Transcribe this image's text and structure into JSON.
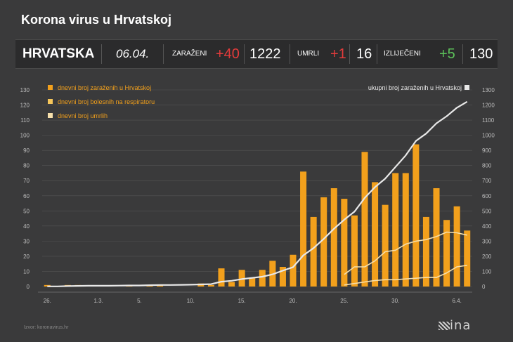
{
  "header": {
    "title": "Korona virus u Hrvatskoj"
  },
  "stats": {
    "country": "HRVATSKA",
    "date": "06.04.",
    "infected_label": "ZARAŽENI",
    "infected_delta": "+40",
    "infected_total": "1222",
    "deaths_label": "UMRLI",
    "deaths_delta": "+1",
    "deaths_total": "16",
    "recovered_label": "IZLIJEČENI",
    "recovered_delta": "+5",
    "recovered_total": "130"
  },
  "colors": {
    "background": "#3a3a3b",
    "bar": "#f2a01c",
    "line_white": "#e8e8e8",
    "line_cream": "#f6dfab",
    "grid": "#555555",
    "red": "#e23b3b",
    "green": "#5cc25a"
  },
  "chart_data": {
    "type": "bar",
    "x_tick_labels": [
      {
        "index": 0,
        "label": "26."
      },
      {
        "index": 5,
        "label": "1.3."
      },
      {
        "index": 9,
        "label": "5."
      },
      {
        "index": 14,
        "label": "10."
      },
      {
        "index": 19,
        "label": "15."
      },
      {
        "index": 24,
        "label": "20."
      },
      {
        "index": 29,
        "label": "25."
      },
      {
        "index": 34,
        "label": "30."
      },
      {
        "index": 40,
        "label": "6.4."
      }
    ],
    "left_axis": {
      "ylim": [
        0,
        130
      ],
      "ticks": [
        "0",
        "10",
        "20",
        "30",
        "40",
        "50",
        "60",
        "70",
        "80",
        "90",
        "100",
        "110",
        "120",
        "130"
      ]
    },
    "right_axis": {
      "ylim": [
        0,
        1300
      ],
      "ticks": [
        "0",
        "100",
        "200",
        "300",
        "400",
        "500",
        "600",
        "700",
        "800",
        "900",
        "1000",
        "1100",
        "1200",
        "1300"
      ]
    },
    "legend_position": "top-left",
    "legend": [
      "dnevni broj zaraženih u Hrvatskoj",
      "dnevni broj bolesnih na respiratoru",
      "dnevni broj umrlih"
    ],
    "right_legend": "ukupni broj zaraženih u Hrvatskoj",
    "series": [
      {
        "name": "dnevni broj zaraženih u Hrvatskoj",
        "axis": "left",
        "type": "bar",
        "values": [
          1,
          0,
          1,
          1,
          0,
          0,
          0,
          0,
          1,
          0,
          1,
          1,
          0,
          0,
          0,
          2,
          1,
          12,
          3,
          11,
          6,
          11,
          17,
          13,
          21,
          76,
          46,
          59,
          65,
          58,
          47,
          89,
          69,
          54,
          75,
          75,
          94,
          46,
          65,
          44,
          53,
          37
        ]
      },
      {
        "name": "ukupni broj zaraženih u Hrvatskoj",
        "axis": "right",
        "type": "line",
        "values": [
          1,
          1,
          3,
          4,
          5,
          5,
          5,
          6,
          7,
          7,
          9,
          10,
          10,
          11,
          12,
          14,
          16,
          32,
          38,
          49,
          57,
          65,
          81,
          105,
          128,
          206,
          254,
          315,
          382,
          442,
          495,
          586,
          657,
          713,
          790,
          867,
          963,
          1011,
          1079,
          1126,
          1182,
          1222
        ]
      },
      {
        "name": "dnevni broj bolesnih na respiratoru",
        "axis": "right",
        "type": "line",
        "start_index": 29,
        "values": [
          80,
          130,
          130,
          170,
          230,
          240,
          280,
          300,
          310,
          330,
          360,
          355,
          340
        ]
      },
      {
        "name": "dnevni broj umrlih",
        "axis": "right",
        "type": "line",
        "start_index": 29,
        "values": [
          10,
          20,
          30,
          40,
          45,
          45,
          50,
          55,
          60,
          60,
          90,
          130,
          140
        ]
      }
    ]
  },
  "footer": {
    "source": "Izvor: koronavirus.hr",
    "logo": "ina"
  }
}
